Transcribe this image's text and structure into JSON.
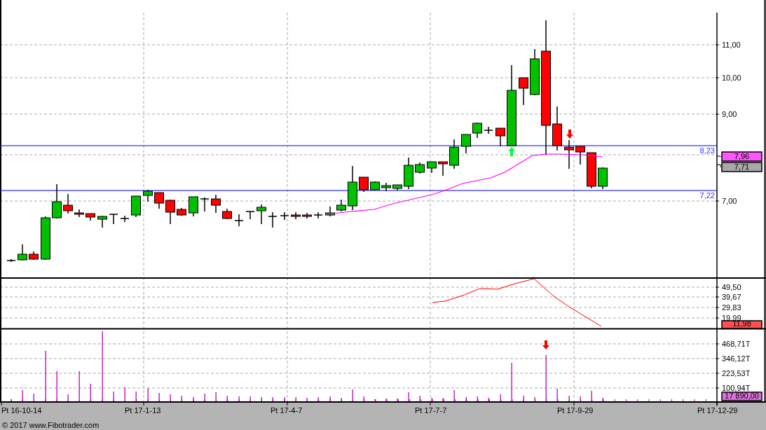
{
  "price_panel": {
    "y_axis_labels": [
      "11,00",
      "10,00",
      "9,00",
      "7,00"
    ],
    "levels": [
      {
        "label": "8,23"
      },
      {
        "label": "7,22"
      }
    ],
    "price_tags": [
      {
        "label": "7,96",
        "color": "#ff55ff"
      },
      {
        "label": "7,71",
        "color": "#a8a8a8"
      }
    ]
  },
  "oscillator_panel": {
    "y_axis_labels": [
      "49,50",
      "39,67",
      "29,83",
      "19,99"
    ],
    "value_tag": {
      "label": "11,98",
      "color": "#ff5050"
    }
  },
  "volume_panel": {
    "y_axis_labels": [
      "468,71T",
      "346,12T",
      "223,53T",
      "100,94T"
    ],
    "value_tag": {
      "label": "17 890,00",
      "color": "#e070e0"
    }
  },
  "x_axis_labels": [
    "Pt 16-10-14",
    "Pt 17-1-13",
    "Pt 17-4-7",
    "Pt 17-7-7",
    "Pt 17-9-29",
    "Pt 17-12-29"
  ],
  "copyright": "© 2017 www.Fibotrader.com"
}
